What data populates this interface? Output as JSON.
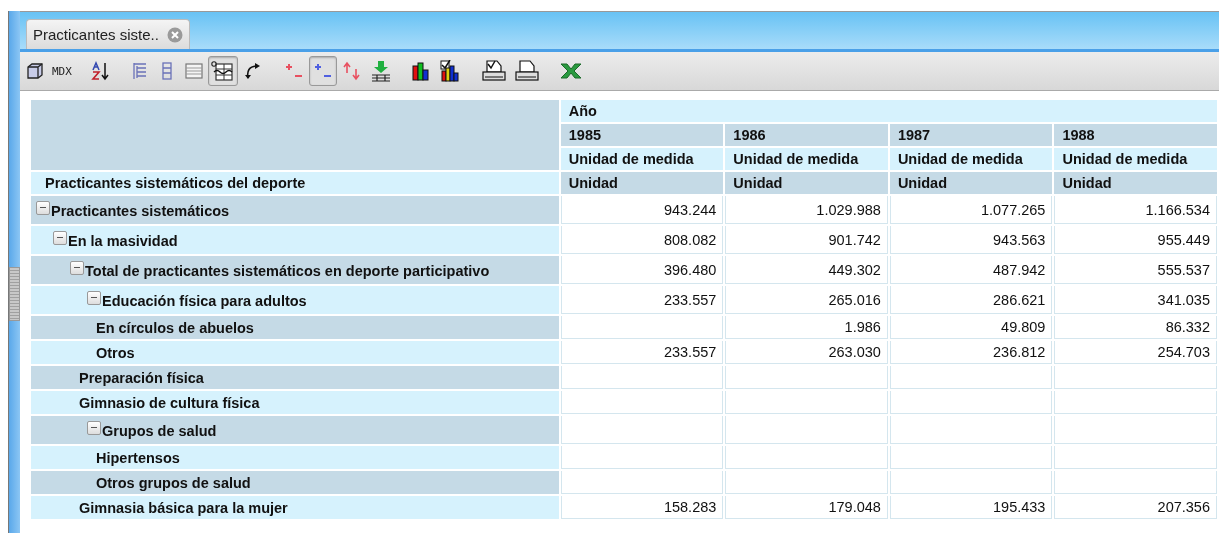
{
  "tab": {
    "label": "Practicantes siste..",
    "selected": true
  },
  "toolbar": [
    {
      "kind": "cube",
      "pressed": false
    },
    {
      "kind": "text",
      "label": "MDX",
      "pressed": false
    },
    {
      "kind": "sort",
      "pressed": false
    },
    {
      "kind": "tree",
      "pressed": false
    },
    {
      "kind": "columns",
      "pressed": false
    },
    {
      "kind": "table",
      "pressed": false
    },
    {
      "kind": "zero-grid",
      "pressed": true
    },
    {
      "kind": "swap",
      "pressed": false
    },
    {
      "kind": "plus-minus",
      "pressed": false
    },
    {
      "kind": "plus-minus-boxed",
      "pressed": true
    },
    {
      "kind": "up-down",
      "pressed": false
    },
    {
      "kind": "download",
      "pressed": false
    },
    {
      "kind": "bar-chart",
      "pressed": false
    },
    {
      "kind": "chart-edit",
      "pressed": false
    },
    {
      "kind": "print-preview",
      "pressed": false
    },
    {
      "kind": "printer",
      "pressed": false
    },
    {
      "kind": "excel",
      "pressed": false
    }
  ],
  "table": {
    "column_dimension": "Año",
    "row_dimension": "Practicantes sistemáticos del deporte",
    "columns": [
      {
        "year": "1985",
        "measure": "Unidad de medida",
        "unit": "Unidad"
      },
      {
        "year": "1986",
        "measure": "Unidad de medida",
        "unit": "Unidad"
      },
      {
        "year": "1987",
        "measure": "Unidad de medida",
        "unit": "Unidad"
      },
      {
        "year": "1988",
        "measure": "Unidad de medida",
        "unit": "Unidad"
      }
    ],
    "rows": [
      {
        "label": "Practicantes sistemáticos",
        "expanded": true,
        "values": [
          "943.244",
          "1.029.988",
          "1.077.265",
          "1.166.534"
        ],
        "children": [
          {
            "label": "En la masividad",
            "expanded": true,
            "values": [
              "808.082",
              "901.742",
              "943.563",
              "955.449"
            ],
            "children": [
              {
                "label": "Total de practicantes sistemáticos en deporte participativo",
                "expanded": true,
                "values": [
                  "396.480",
                  "449.302",
                  "487.942",
                  "555.537"
                ],
                "children": [
                  {
                    "label": "Educación física para adultos",
                    "expanded": true,
                    "values": [
                      "233.557",
                      "265.016",
                      "286.621",
                      "341.035"
                    ],
                    "children": [
                      {
                        "label": "En círculos de abuelos",
                        "values": {
                          "col_2": "1.986",
                          "col_3": "49.809",
                          "col_4": "86.332"
                        }
                      },
                      {
                        "label": "Otros",
                        "values": [
                          "233.557",
                          "263.030",
                          "236.812",
                          "254.703"
                        ]
                      }
                    ]
                  },
                  {
                    "label": "Preparación física"
                  },
                  {
                    "label": "Gimnasio de cultura física"
                  },
                  {
                    "label": "Grupos de salud",
                    "expanded": true,
                    "children": [
                      {
                        "label": "Hipertensos"
                      },
                      {
                        "label": "Otros grupos de salud"
                      }
                    ]
                  },
                  {
                    "label": "Gimnasia básica para la mujer",
                    "values": [
                      "158.283",
                      "179.048",
                      "195.433",
                      "207.356"
                    ]
                  }
                ]
              }
            ]
          }
        ]
      }
    ]
  }
}
